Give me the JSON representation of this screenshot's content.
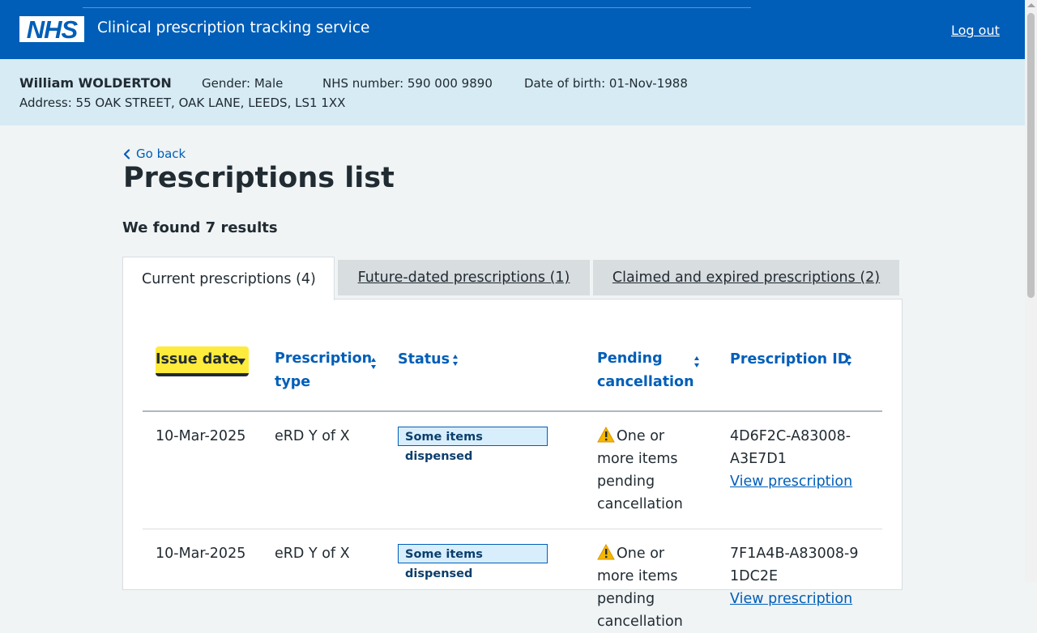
{
  "header": {
    "logo_text": "NHS",
    "service_name": "Clinical prescription tracking service",
    "logout_label": "Log out"
  },
  "patient": {
    "name": "William WOLDERTON",
    "gender": "Gender: Male",
    "nhs_number": "NHS number: 590 000 9890",
    "dob": "Date of birth: 01-Nov-1988",
    "address": "Address: 55 OAK STREET, OAK LANE, LEEDS, LS1 1XX"
  },
  "nav": {
    "back_label": "Go back"
  },
  "page": {
    "title": "Prescriptions list",
    "results": "We found 7 results"
  },
  "tabs": [
    {
      "label": "Current prescriptions (4)",
      "active": true
    },
    {
      "label": "Future-dated prescriptions (1)",
      "active": false
    },
    {
      "label": "Claimed and expired prescriptions (2)",
      "active": false
    }
  ],
  "table": {
    "columns": [
      {
        "label": "Issue date",
        "sort": "descending"
      },
      {
        "label": "Prescription type",
        "sort": "none"
      },
      {
        "label": "Status",
        "sort": "none"
      },
      {
        "label": "Pending cancellation",
        "sort": "none"
      },
      {
        "label": "Prescription ID",
        "sort": "none"
      }
    ],
    "rows": [
      {
        "issue_date": "10-Mar-2025",
        "type": "eRD Y of X",
        "status": "Some items dispensed",
        "pending": "One or more items pending cancellation",
        "id": "4D6F2C-A83008-A3E7D1",
        "link": "View prescription"
      },
      {
        "issue_date": "10-Mar-2025",
        "type": "eRD Y of X",
        "status": "Some items dispensed",
        "pending": "One or more items pending cancellation",
        "id": "7F1A4B-A83008-91DC2E",
        "link": "View prescription"
      }
    ]
  },
  "colors": {
    "nhs_blue": "#005eb8",
    "banner_blue": "#d7ebf5",
    "page_background": "#f0f4f5",
    "sort_highlight": "#ffeb3b",
    "tag_background": "#d8eefc",
    "tag_text": "#0b3e6d"
  },
  "icons": {
    "back": "chevron-left-icon",
    "warning": "warning-icon",
    "sort": "sort-arrows-icon",
    "sort_active": "sort-descending-icon"
  }
}
